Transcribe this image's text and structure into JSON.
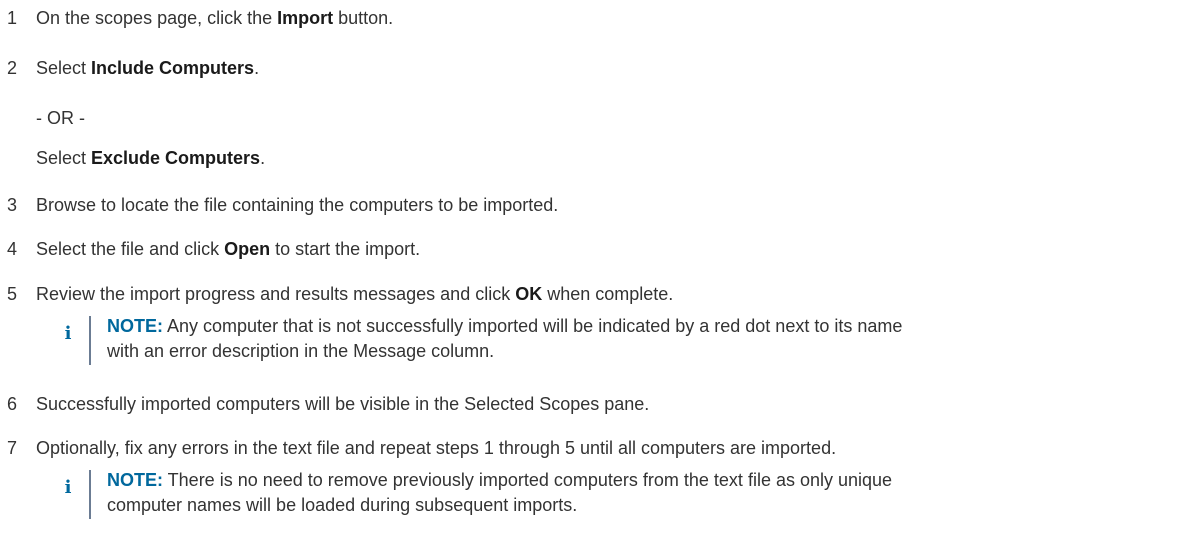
{
  "steps": [
    {
      "num": "1",
      "pre": "On the scopes page, click the ",
      "bold": "Import",
      "post": " button."
    },
    {
      "num": "2",
      "pre": "Select ",
      "bold": "Include Computers",
      "post": "."
    },
    {
      "or": "- OR -"
    },
    {
      "pre": "Select ",
      "bold": "Exclude Computers",
      "post": "."
    },
    {
      "num": "3",
      "text": "Browse to locate the file containing the computers to be imported."
    },
    {
      "num": "4",
      "pre": "Select the file and click ",
      "bold": "Open",
      "post": " to start the import."
    },
    {
      "num": "5",
      "pre": "Review the import progress and results messages and click ",
      "bold": "OK",
      "post": " when complete."
    },
    {
      "num": "6",
      "text": "Successfully imported computers will be visible in the Selected Scopes pane."
    },
    {
      "num": "7",
      "text": "Optionally, fix any errors in the text file and repeat steps 1 through 5 until all computers are imported."
    }
  ],
  "notes": [
    {
      "icon": "i",
      "label": "NOTE:",
      "line1": " Any computer that is not successfully imported will be indicated by a red dot next to its name",
      "line2": "with an error description in the Message column."
    },
    {
      "icon": "i",
      "label": "NOTE:",
      "line1": " There is no need to remove previously imported computers from the text file as only unique",
      "line2": "computer names will be loaded during subsequent imports."
    }
  ],
  "colors": {
    "text": "#333333",
    "note_accent": "#00689d",
    "note_bar": "#6b7c93"
  }
}
